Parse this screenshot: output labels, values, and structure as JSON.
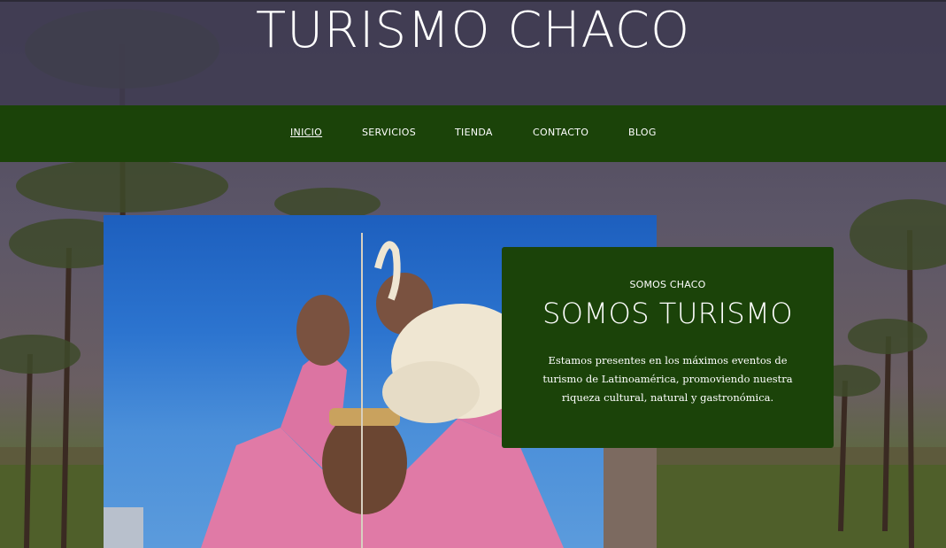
{
  "header": {
    "site_title": "TURISMO CHACO"
  },
  "nav": {
    "items": [
      {
        "label": "INICIO",
        "active": true
      },
      {
        "label": "SERVICIOS",
        "active": false
      },
      {
        "label": "TIENDA",
        "active": false
      },
      {
        "label": "CONTACTO",
        "active": false
      },
      {
        "label": "BLOG",
        "active": false
      }
    ]
  },
  "hero": {
    "kicker": "SOMOS CHACO",
    "title": "SOMOS TURISMO",
    "body": "Estamos presentes en los máximos eventos de turismo de Latinoamérica, promoviendo nuestra riqueza cultural, natural y gastronómica."
  },
  "colors": {
    "nav_bg": "#1b4309",
    "card_bg": "#1b4309",
    "header_overlay": "#403c52",
    "text": "#ffffff"
  }
}
